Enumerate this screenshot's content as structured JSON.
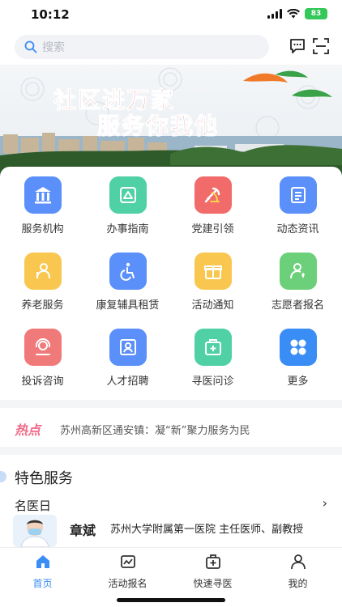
{
  "status_bar": {
    "time": "10:12",
    "battery": "83"
  },
  "search": {
    "placeholder": "搜索"
  },
  "banner": {
    "line1": "社区进万家",
    "line2": "服务你我他"
  },
  "grid": [
    {
      "label": "服务机构",
      "icon": "institution-icon",
      "color": "#5b8ff9"
    },
    {
      "label": "办事指南",
      "icon": "guide-icon",
      "color": "#4fd1a5"
    },
    {
      "label": "党建引领",
      "icon": "party-icon",
      "color": "#f26b6b"
    },
    {
      "label": "动态资讯",
      "icon": "news-icon",
      "color": "#5b8ff9"
    },
    {
      "label": "养老服务",
      "icon": "elderly-icon",
      "color": "#f9c74f"
    },
    {
      "label": "康复辅具租赁",
      "icon": "wheelchair-icon",
      "color": "#5b8ff9"
    },
    {
      "label": "活动通知",
      "icon": "gift-icon",
      "color": "#f9c74f"
    },
    {
      "label": "志愿者报名",
      "icon": "volunteer-icon",
      "color": "#6ccf7a"
    },
    {
      "label": "投诉咨询",
      "icon": "headset-icon",
      "color": "#f07a7a"
    },
    {
      "label": "人才招聘",
      "icon": "recruit-icon",
      "color": "#5b8ff9"
    },
    {
      "label": "寻医问诊",
      "icon": "medical-icon",
      "color": "#4fd1a5"
    },
    {
      "label": "更多",
      "icon": "more-icon",
      "color": "#3a8df5"
    }
  ],
  "hot": {
    "tag": "热点",
    "text": "苏州高新区通安镇：凝“新”聚力服务为民"
  },
  "featured": {
    "title": "特色服务",
    "section": "名医日",
    "doctor_name": "章斌",
    "doctor_info": "苏州大学附属第一医院 主任医师、副教授"
  },
  "tabs": [
    {
      "label": "首页",
      "icon": "home-icon",
      "active": true
    },
    {
      "label": "活动报名",
      "icon": "activity-icon",
      "active": false
    },
    {
      "label": "快速寻医",
      "icon": "medical-kit-icon",
      "active": false
    },
    {
      "label": "我的",
      "icon": "user-icon",
      "active": false
    }
  ],
  "colors": {
    "accent": "#3a8df5",
    "banner_text": "#d8232a",
    "hot_tag": "#f06a8a"
  }
}
